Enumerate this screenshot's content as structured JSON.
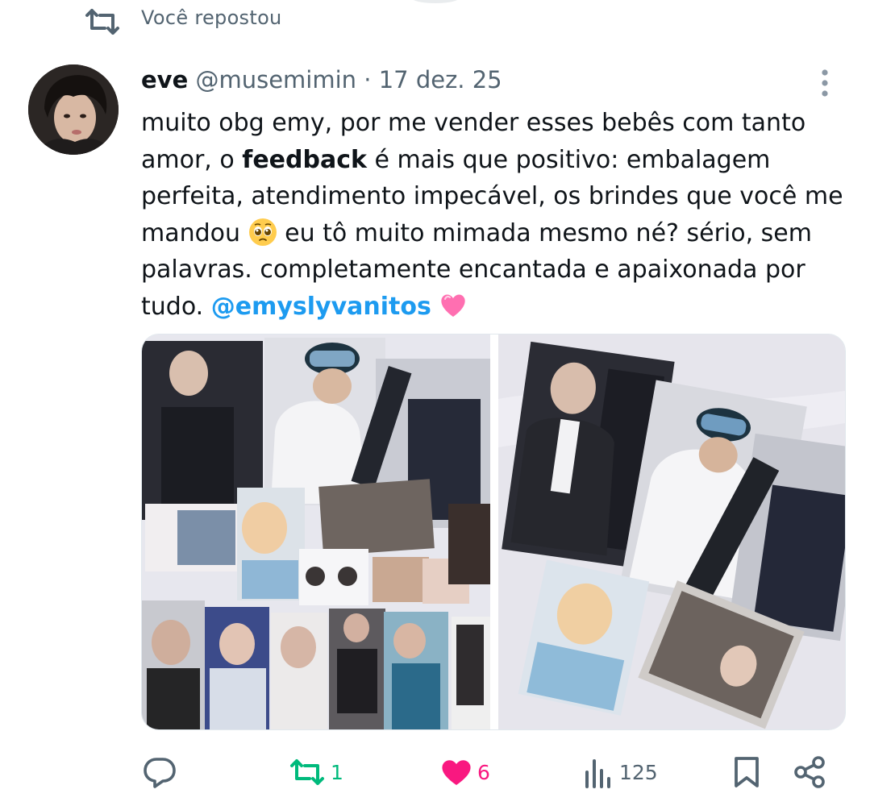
{
  "repost_banner": {
    "icon": "repost-icon",
    "text": "Você repostou"
  },
  "tweet": {
    "author_name": "eve",
    "handle": "@musemimin",
    "separator": "·",
    "date": "17 dez. 25",
    "text_part1": "muito obg emy, por me vender esses bebês com tanto amor, o ",
    "text_bold": "feedback",
    "text_part2": " é mais que positivo: embalagem perfeita, atendimento impecável, os brindes que você me mandou ",
    "emoji1": "pleading-face-emoji",
    "text_part3": " eu tô muito mimada mesmo né? sério, sem palavras. completamente encantada e apaixonada por tudo.  ",
    "mention": "@emyslyvanitos",
    "emoji2": "pink-heart-emoji"
  },
  "media": [
    {
      "name": "photocard-collage-photo"
    },
    {
      "name": "photocards-on-bed-photo"
    }
  ],
  "actions": {
    "reply": {
      "icon": "reply-icon",
      "count": ""
    },
    "repost": {
      "icon": "repost-icon",
      "count": "1",
      "color": "#00ba7c"
    },
    "like": {
      "icon": "heart-icon",
      "count": "6",
      "color": "#f91880"
    },
    "views": {
      "icon": "views-icon",
      "count": "125"
    },
    "bookmark": {
      "icon": "bookmark-icon"
    },
    "share": {
      "icon": "share-icon"
    }
  },
  "colors": {
    "mention": "#1d9bf0",
    "muted": "#536471",
    "text": "#0f1419"
  }
}
